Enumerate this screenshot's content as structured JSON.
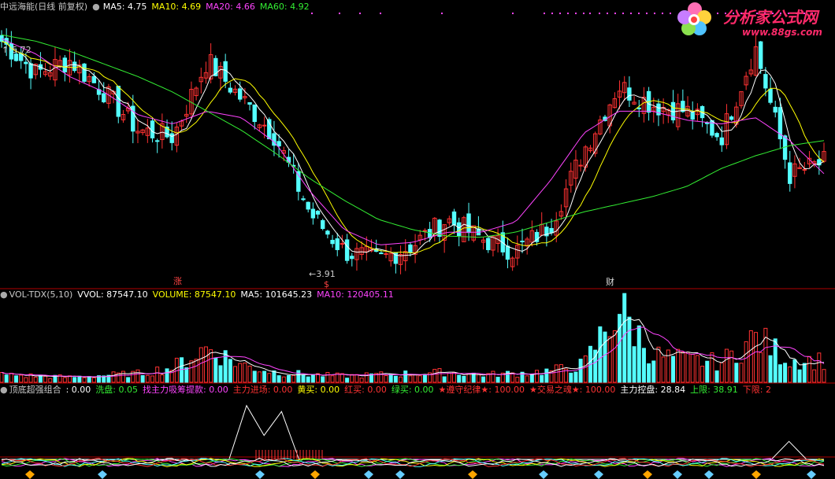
{
  "header_main": {
    "title": "中远海能(日线 前复权)",
    "ma5": "MA5: 4.75",
    "ma10": "MA10: 4.69",
    "ma20": "MA20: 4.66",
    "ma60": "MA60: 4.92"
  },
  "header_volume": {
    "title": "VOL-TDX(5,10)",
    "vvol": "VVOL: 87547.10",
    "volume": "VOLUME: 87547.10",
    "ma5": "MA5: 101645.23",
    "ma10": "MA10: 120405.11"
  },
  "header_indicator": {
    "title": "顶底超强组合",
    "v0": ": 0.00",
    "xipan": "洗盘: 0.05",
    "zhaozhuli": "找主力吸筹提款: 0.00",
    "zhulijinchang": "主力进场: 0.00",
    "huangmai": "黄买: 0.00",
    "hongmai": "红买: 0.00",
    "lvmai": "绿买: 0.00",
    "zunshou": "★遵守纪律★: 100.00",
    "jiaoyi": "★交易之魂★: 100.00",
    "zhulikongpan": "主力控盘: 28.84",
    "shangxian": "上限: 38.91",
    "xiaxian": "下限: 2"
  },
  "logo": {
    "name": "分析家公式网",
    "url": "www.88gs.com"
  },
  "annotations": {
    "high": "5.72",
    "low": "3.91",
    "mark_zhang": "涨",
    "mark_s": "$",
    "mark_cai": "财"
  },
  "colors": {
    "up": "#ff3232",
    "down": "#54ffff",
    "ma5": "#ffffff",
    "ma10": "#ffff00",
    "ma20": "#ff44ff",
    "ma60": "#33ee33",
    "separator": "#b00000"
  },
  "chart_data": [
    {
      "type": "line",
      "title": "中远海能(日线 前复权)",
      "ylim": [
        3.8,
        5.9
      ],
      "series": [
        {
          "name": "MA60",
          "values": [
            5.75,
            5.7,
            5.62,
            5.52,
            5.42,
            5.3,
            5.15,
            5.0,
            4.82,
            4.62,
            4.45,
            4.3,
            4.22,
            4.17,
            4.16,
            4.2,
            4.28,
            4.36,
            4.42,
            4.48,
            4.56,
            4.7,
            4.8,
            4.88,
            4.92
          ]
        },
        {
          "name": "MA20",
          "values": [
            5.72,
            5.6,
            5.42,
            5.3,
            5.12,
            5.05,
            5.15,
            5.1,
            4.9,
            4.52,
            4.22,
            4.1,
            4.12,
            4.2,
            4.2,
            4.28,
            4.6,
            4.98,
            5.15,
            5.15,
            5.08,
            5.05,
            5.1,
            4.92,
            4.66
          ]
        }
      ],
      "close": [
        5.7,
        5.45,
        5.55,
        5.3,
        5.0,
        4.95,
        5.55,
        5.25,
        4.95,
        4.35,
        4.05,
        3.98,
        4.1,
        4.3,
        4.15,
        4.05,
        4.25,
        4.85,
        5.35,
        5.2,
        5.15,
        4.95,
        5.65,
        4.65,
        4.75
      ]
    },
    {
      "type": "bar",
      "title": "VOL-TDX(5,10)",
      "series": [
        {
          "name": "VOLUME",
          "values": [
            30,
            25,
            20,
            28,
            35,
            60,
            140,
            70,
            40,
            30,
            25,
            30,
            35,
            40,
            30,
            35,
            45,
            70,
            300,
            110,
            90,
            80,
            180,
            90,
            87
          ]
        }
      ]
    },
    {
      "type": "line",
      "title": "顶底超强组合",
      "series": [
        {
          "name": "主力控盘",
          "values": [
            0,
            0,
            0,
            0,
            0,
            0,
            0,
            0,
            0,
            0,
            0,
            0,
            0,
            0,
            90,
            40,
            80,
            0,
            0,
            0,
            0,
            0,
            0,
            0,
            0,
            0,
            0,
            0,
            0,
            0,
            0,
            0,
            0,
            0,
            0,
            0,
            0,
            0,
            0,
            0,
            0,
            0,
            0,
            0,
            0,
            30,
            0,
            0
          ]
        }
      ]
    }
  ]
}
